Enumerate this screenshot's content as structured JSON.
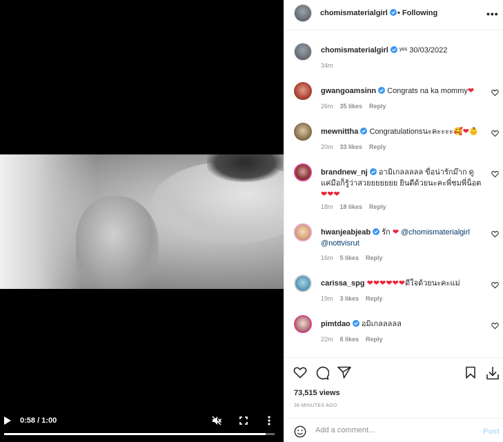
{
  "video": {
    "time": "0:58 / 1:00",
    "progress": 0.967,
    "icons": [
      "play-icon",
      "mute-icon",
      "fullscreen-icon",
      "more-vertical-icon"
    ]
  },
  "header": {
    "username": "chomismaterialgirl",
    "follow_label": "• Following",
    "more_label": "•••"
  },
  "caption": {
    "username": "chomismaterialgirl",
    "text": "ʸᵉˢ 30/03/2022",
    "time": "34m"
  },
  "comments": [
    {
      "username": "gwangoamsinn",
      "text": "Congrats na ka mommy",
      "emoji": "❤",
      "time": "26m",
      "likes": "35 likes",
      "reply": "Reply"
    },
    {
      "username": "mewnittha",
      "text": "Congratulationsนะคะะะะ",
      "emoji": "🥰❤👶",
      "time": "20m",
      "likes": "33 likes",
      "reply": "Reply"
    },
    {
      "username": "brandnew_nj",
      "text": "อามิเกลลลลล ขื่อน่ารักม๊าก ดูแค่มือก็รู้ว่าสวยยยยยยย ยินดีด้วยนะคะพี่ชมพี่น็อต",
      "emoji": "❤❤❤",
      "time": "18m",
      "likes": "18 likes",
      "reply": "Reply"
    },
    {
      "username": "hwanjeabjeab",
      "text": "รัก",
      "emoji": "❤",
      "mention1": "@chomismaterialgirl",
      "mention2": "@nottvisrut",
      "time": "16m",
      "likes": "5 likes",
      "reply": "Reply"
    },
    {
      "username": "carissa_spg",
      "text": "ดีใจด้วยนะคะแม่",
      "emoji": "❤❤❤❤❤❤",
      "time": "19m",
      "likes": "3 likes",
      "reply": "Reply"
    },
    {
      "username": "pimtdao",
      "text": "อมิเกลลลลล",
      "emoji": "",
      "time": "22m",
      "likes": "8 likes",
      "reply": "Reply"
    }
  ],
  "stats": {
    "views": "73,515 views",
    "posted": "36 MINUTES AGO"
  },
  "add_comment": {
    "placeholder": "Add a comment...",
    "post_label": "Post"
  },
  "colors": {
    "verified": "#3897f0",
    "heart": "#ed2134",
    "post_disabled": "#b2dffc"
  }
}
